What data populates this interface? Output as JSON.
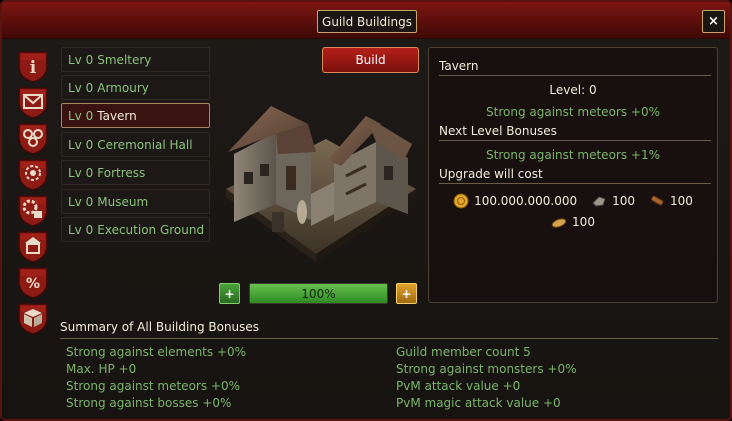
{
  "window": {
    "title": "Guild Buildings",
    "close_label": "×"
  },
  "sidebar_icons": [
    {
      "name": "info-icon"
    },
    {
      "name": "mail-icon"
    },
    {
      "name": "members-icon"
    },
    {
      "name": "gear-badge-icon"
    },
    {
      "name": "settings-icon"
    },
    {
      "name": "guild-building-icon"
    },
    {
      "name": "percent-icon"
    },
    {
      "name": "box-icon"
    }
  ],
  "buildings": [
    {
      "level": "Lv 0",
      "name": "Smeltery"
    },
    {
      "level": "Lv 0",
      "name": "Armoury"
    },
    {
      "level": "Lv 0",
      "name": "Tavern"
    },
    {
      "level": "Lv 0",
      "name": "Ceremonial Hall"
    },
    {
      "level": "Lv 0",
      "name": "Fortress"
    },
    {
      "level": "Lv 0",
      "name": "Museum"
    },
    {
      "level": "Lv 0",
      "name": "Execution Ground"
    }
  ],
  "selected_building": "Tavern",
  "build_button": "Build",
  "progress": {
    "value": 100,
    "label": "100%",
    "minus": "+",
    "plus": "+"
  },
  "details": {
    "name": "Tavern",
    "level_text": "Level: 0",
    "current_bonus": "Strong against meteors +0%",
    "next_level_heading": "Next Level Bonuses",
    "next_bonus": "Strong against meteors +1%",
    "upgrade_heading": "Upgrade will cost",
    "costs": [
      {
        "icon": "gold-coin-icon",
        "value": "100.000.000.000"
      },
      {
        "icon": "stone-icon",
        "value": "100"
      },
      {
        "icon": "wood-icon",
        "value": "100"
      },
      {
        "icon": "bread-icon",
        "value": "100"
      }
    ]
  },
  "summary": {
    "title": "Summary of All Building Bonuses",
    "left": [
      "Strong against elements +0%",
      "Max. HP +0",
      "Strong against meteors +0%",
      "Strong against bosses +0%"
    ],
    "right": [
      "Guild member count 5",
      "Strong against monsters +0%",
      "PvM attack value +0",
      "PvM magic attack value +0"
    ]
  },
  "colors": {
    "accent_red": "#b51f19",
    "bonus_green": "#7cb46a",
    "gold_border": "#c9a66b"
  }
}
